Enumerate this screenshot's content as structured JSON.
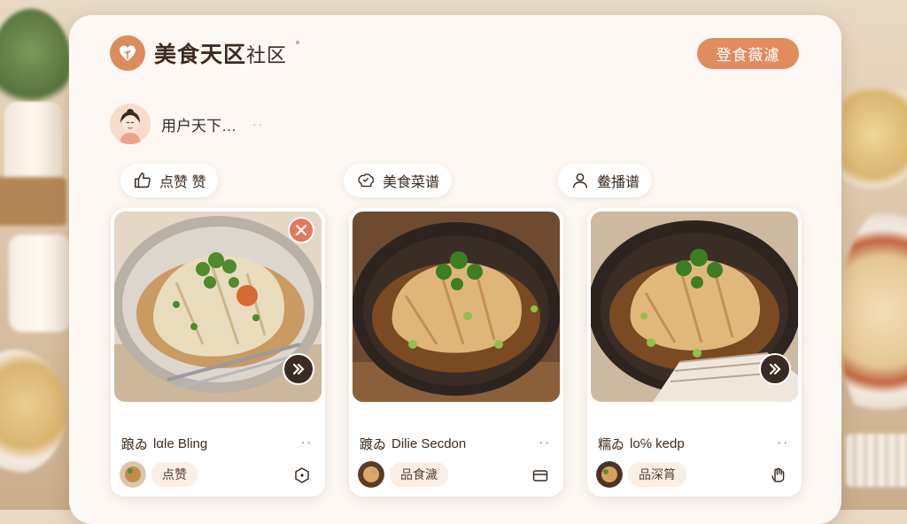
{
  "header": {
    "app_title": "美食天区",
    "app_title_suffix": "社区",
    "login_button": "登食薇濾"
  },
  "user": {
    "name": "用户天下…",
    "more": "··"
  },
  "chips": [
    {
      "icon": "thumbs-up-icon",
      "label": "点赞  赞"
    },
    {
      "icon": "recipe-icon",
      "label": "美食菜谱"
    },
    {
      "icon": "user-icon",
      "label": "鲞播谱"
    }
  ],
  "cards": [
    {
      "meta_prefix": "踉ゐ",
      "meta_title": "lαle Bling",
      "more": "··",
      "tag": "点赞",
      "foot_icon": "shield-icon",
      "overlay_icon": "close-icon"
    },
    {
      "meta_prefix": "踱ゐ",
      "meta_title": "Dilie Secdon",
      "more": "··",
      "tag": "品食濊",
      "foot_icon": "wallet-icon"
    },
    {
      "meta_prefix": "糯ゐ",
      "meta_title": "lo℅ kedp",
      "more": "··",
      "tag": "品深筲",
      "foot_icon": "hand-icon"
    }
  ],
  "colors": {
    "accent": "#e08c5e",
    "panel": "#fdf8f3",
    "text": "#3a2a20"
  }
}
